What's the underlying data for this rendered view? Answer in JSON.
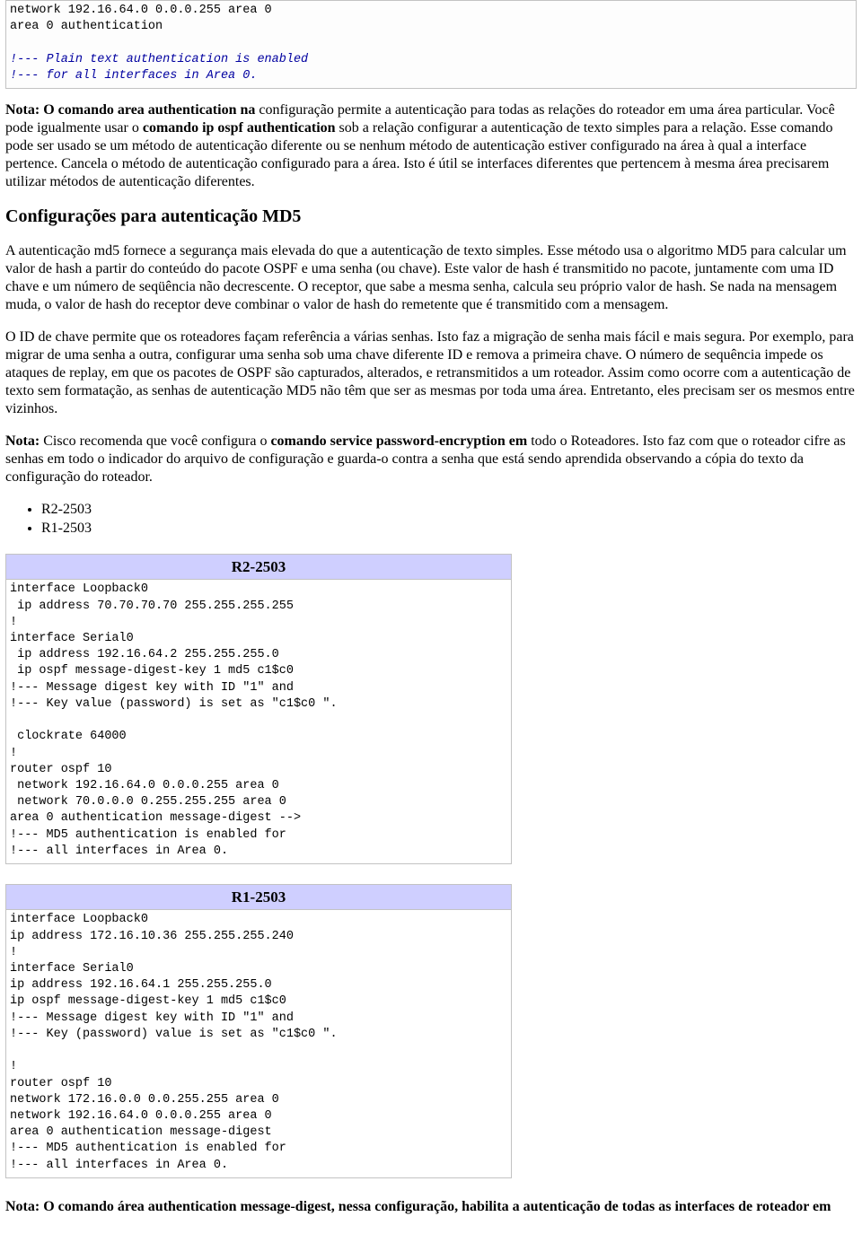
{
  "top_code": {
    "plain1": "network 192.16.64.0 0.0.0.255 area 0\narea 0 authentication\n",
    "comment1": "!--- Plain text authentication is enabled\n!--- for all interfaces in Area 0."
  },
  "para1": {
    "b1": "Nota: O comando area authentication na",
    "t1": " configuração permite a autenticação para todas as relações do roteador em uma área particular. Você pode igualmente usar o ",
    "b2": "comando ip ospf authentication",
    "t2": " sob a relação configurar a autenticação de texto simples para a relação. Esse comando pode ser usado se um método de autenticação diferente ou se nenhum método de autenticação estiver configurado na área à qual a interface pertence. Cancela o método de autenticação configurado para a área. Isto é útil se interfaces diferentes que pertencem à mesma área precisarem utilizar métodos de autenticação diferentes."
  },
  "heading_md5": "Configurações para autenticação MD5",
  "para2": "A autenticação md5 fornece a segurança mais elevada do que a autenticação de texto simples. Esse método usa o algoritmo MD5 para calcular um valor de hash a partir do conteúdo do pacote OSPF e uma senha (ou chave). Este valor de hash é transmitido no pacote, juntamente com uma ID chave e um número de seqüência não decrescente. O receptor, que sabe a mesma senha, calcula seu próprio valor de hash. Se nada na mensagem muda, o valor de hash do receptor deve combinar o valor de hash do remetente que é transmitido com a mensagem.",
  "para3": "O ID de chave permite que os roteadores façam referência a várias senhas. Isto faz a migração de senha mais fácil e mais segura. Por exemplo, para migrar de uma senha a outra, configurar uma senha sob uma chave diferente ID e remova a primeira chave. O número de sequência impede os ataques de replay, em que os pacotes de OSPF são capturados, alterados, e retransmitidos a um roteador. Assim como ocorre com a autenticação de texto sem formatação, as senhas de autenticação MD5 não têm que ser as mesmas por toda uma área. Entretanto, eles precisam ser os mesmos entre vizinhos.",
  "para4": {
    "b1": "Nota:",
    "t1": " Cisco recomenda que você configura o ",
    "b2": "comando service password-encryption em",
    "t2": " todo o Roteadores. Isto faz com que o roteador cifre as senhas em todo o indicador do arquivo de configuração e guarda-o contra a senha que está sendo aprendida observando a cópia do texto da configuração do roteador."
  },
  "list_items": [
    "R2-2503",
    "R1-2503"
  ],
  "config_tables": [
    {
      "title": "R2-2503",
      "pre": [
        {
          "style": "plain",
          "text": "interface Loopback0\n ip address 70.70.70.70 255.255.255.255\n!\ninterface Serial0\n ip address 192.16.64.2 255.255.255.0\n ip ospf message-digest-key 1 md5 c1$c0\n"
        },
        {
          "style": "comment",
          "text": "!--- Message digest key with ID \"1\" and\n!--- Key value (password) is set as \"c1$c0 \".\n"
        },
        {
          "style": "plain",
          "text": "\n clockrate 64000\n!\nrouter ospf 10\n network 192.16.64.0 0.0.0.255 area 0\n network 70.0.0.0 0.255.255.255 area 0\narea 0 authentication message-digest -->\n"
        },
        {
          "style": "comment",
          "text": "!--- MD5 authentication is enabled for\n!--- all interfaces in Area 0.\n"
        }
      ]
    },
    {
      "title": "R1-2503",
      "pre": [
        {
          "style": "plain",
          "text": "interface Loopback0\nip address 172.16.10.36 255.255.255.240\n!\ninterface Serial0\nip address 192.16.64.1 255.255.255.0\nip ospf message-digest-key 1 md5 c1$c0\n"
        },
        {
          "style": "comment",
          "text": "!--- Message digest key with ID \"1\" and\n!--- Key (password) value is set as \"c1$c0 \".\n"
        },
        {
          "style": "plain",
          "text": "\n!\nrouter ospf 10\nnetwork 172.16.0.0 0.0.255.255 area 0\nnetwork 192.16.64.0 0.0.0.255 area 0\narea 0 authentication message-digest\n"
        },
        {
          "style": "comment",
          "text": "!--- MD5 authentication is enabled for\n!--- all interfaces in Area 0.\n"
        }
      ]
    }
  ],
  "para5": {
    "b1": "Nota: O comando área authentication message-digest, nessa configuração, habilita a autenticação de todas as interfaces de roteador em"
  }
}
